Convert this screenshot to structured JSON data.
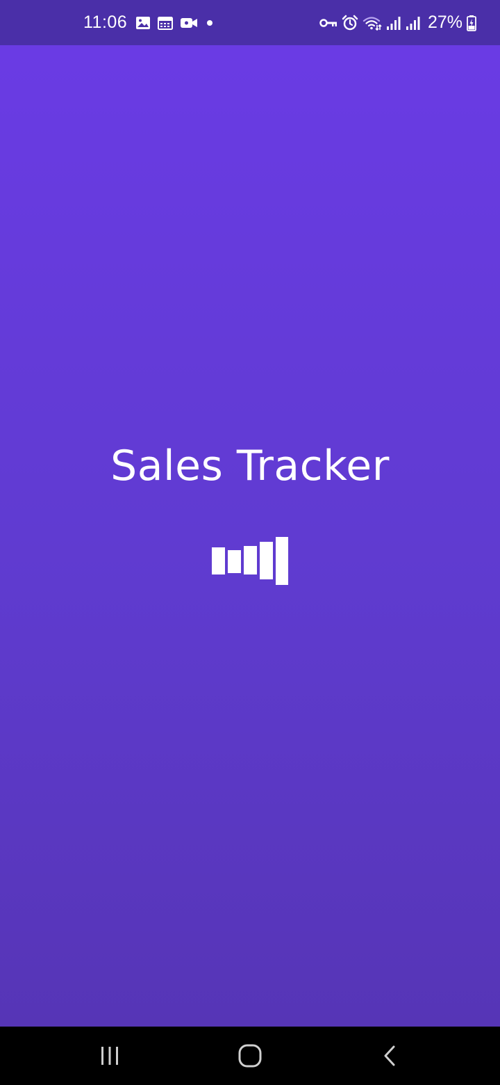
{
  "status_bar": {
    "time": "11:06",
    "battery": "27%",
    "left_icons": [
      "gallery-icon",
      "calendar-icon",
      "video-icon",
      "dot-icon"
    ],
    "right_icons": [
      "vpn-key-icon",
      "alarm-icon",
      "wifi-icon",
      "signal-icon",
      "signal-icon",
      "battery-charging-icon"
    ]
  },
  "splash": {
    "title": "Sales Tracker",
    "logo_icon": "bar-chart-icon",
    "background_top": "#6a3be4",
    "background_bottom": "#5635b6"
  },
  "nav_bar": {
    "buttons": [
      "recent-apps",
      "home",
      "back"
    ]
  }
}
